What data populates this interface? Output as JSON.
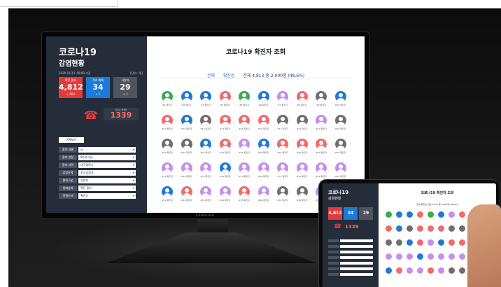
{
  "monitor": {
    "brand": "SAMSUNG",
    "left": {
      "title1": "코로나19",
      "title2": "감염현황",
      "date": "2020.03.20. 09:00 기준",
      "unit": "[단위 : 명]",
      "stats": [
        {
          "label": "확진 환자",
          "value": "4,812",
          "delta": "+ 600",
          "color": "#e33b3b"
        },
        {
          "label": "격리 해제",
          "value": "34",
          "delta": "+ 5",
          "color": "#1e7ad8"
        },
        {
          "label": "사망자",
          "value": "29",
          "delta": "+ 1",
          "color": "#4f545f"
        }
      ],
      "phone_label": "코로나 콜센터",
      "phone_value": "1339",
      "all_button": "전체보기",
      "filters": [
        {
          "label": "환자 성별",
          "value": "남"
        },
        {
          "label": "환자 연령",
          "value": "80세 이상"
        },
        {
          "label": "환자 지역",
          "value": "대구광역시"
        },
        {
          "label": "감염단계",
          "value": "3차 감염자"
        },
        {
          "label": "환자구분",
          "value": "신천지"
        },
        {
          "label": "현재상태",
          "value": "확진 환자"
        },
        {
          "label": "정렬순서",
          "value": "확진순"
        }
      ]
    },
    "right": {
      "title": "코로나19 확진자 조회",
      "tabs": [
        "전체",
        "확진순"
      ],
      "summary": "전체 4,812 중 2,000명 (48.6%)",
      "rows": [
        {
          "labels": [
            "#1 확진자",
            "#2 확진자",
            "#3 확진자",
            "#4 확진자",
            "#5 확진자",
            "#6 확진자",
            "#7 확진자",
            "#8 확진자",
            "#9 확진자",
            "#10 확진자"
          ],
          "colors": [
            "#3ea94f",
            "#1e7ad8",
            "#1e7ad8",
            "#f26a6a",
            "#3ea94f",
            "#1e7ad8",
            "#c68ef0",
            "#f26a6a",
            "#6f6f6f",
            "#1e7ad8"
          ]
        },
        {
          "labels": [
            "#11 확진자",
            "#12 확진자",
            "#13 확진자",
            "#14 확진자",
            "#15 확진자",
            "#16 확진자",
            "#17 확진자",
            "#18 확진자",
            "#19 확진자",
            "#20 확진자"
          ],
          "colors": [
            "#f26a6a",
            "#1e7ad8",
            "#6f6f6f",
            "#f26a6a",
            "#f26a6a",
            "#f26a6a",
            "#6f6f6f",
            "#6f6f6f",
            "#c68ef0",
            "#6f6f6f"
          ]
        },
        {
          "labels": [
            "#21 확진자",
            "#22 확진자",
            "#23 확진자",
            "#24 확진자",
            "#25 확진자",
            "#26 확진자",
            "#27 확진자",
            "#28 확진자",
            "#29 확진자",
            "#30 확진자"
          ],
          "colors": [
            "#6f6f6f",
            "#6f6f6f",
            "#1e7ad8",
            "#f26a6a",
            "#c68ef0",
            "#1e7ad8",
            "#f26a6a",
            "#f26a6a",
            "#f26a6a",
            "#6f6f6f"
          ]
        },
        {
          "labels": [
            "#31 확진자",
            "#32 확진자",
            "#33 확진자",
            "#34 확진자",
            "#35 확진자",
            "#36 확진자",
            "#37 확진자",
            "#38 확진자",
            "#39 확진자",
            "#40 확진자"
          ],
          "colors": [
            "#c68ef0",
            "#c68ef0",
            "#c68ef0",
            "#1e7ad8",
            "#c68ef0",
            "#c68ef0",
            "#c68ef0",
            "#c68ef0",
            "#c68ef0",
            "#c68ef0"
          ]
        },
        {
          "labels": [
            "#41 확진자",
            "#42 확진자",
            "#43 확진자",
            "#44 확진자",
            "#45 확진자",
            "#46 확진자",
            "#47 확진자",
            "#48 확진자",
            "#49 확진자",
            "#50 확진자"
          ],
          "colors": [
            "#1e7ad8",
            "#f26a6a",
            "#c68ef0",
            "#c68ef0",
            "#f26a6a",
            "#c68ef0",
            "#6f6f6f",
            "#6f6f6f",
            "#c68ef0",
            "#c68ef0"
          ]
        }
      ]
    }
  },
  "tablet": {
    "title1": "코로나19",
    "title2": "감염현황",
    "stats": [
      "4,812",
      "34",
      "29"
    ],
    "phone_value": "1339",
    "title": "코로나19 확진자 조회",
    "tabs": [
      "전체",
      "확진순",
      "전체 4,812 중 2,000명 (48.6%)"
    ]
  }
}
